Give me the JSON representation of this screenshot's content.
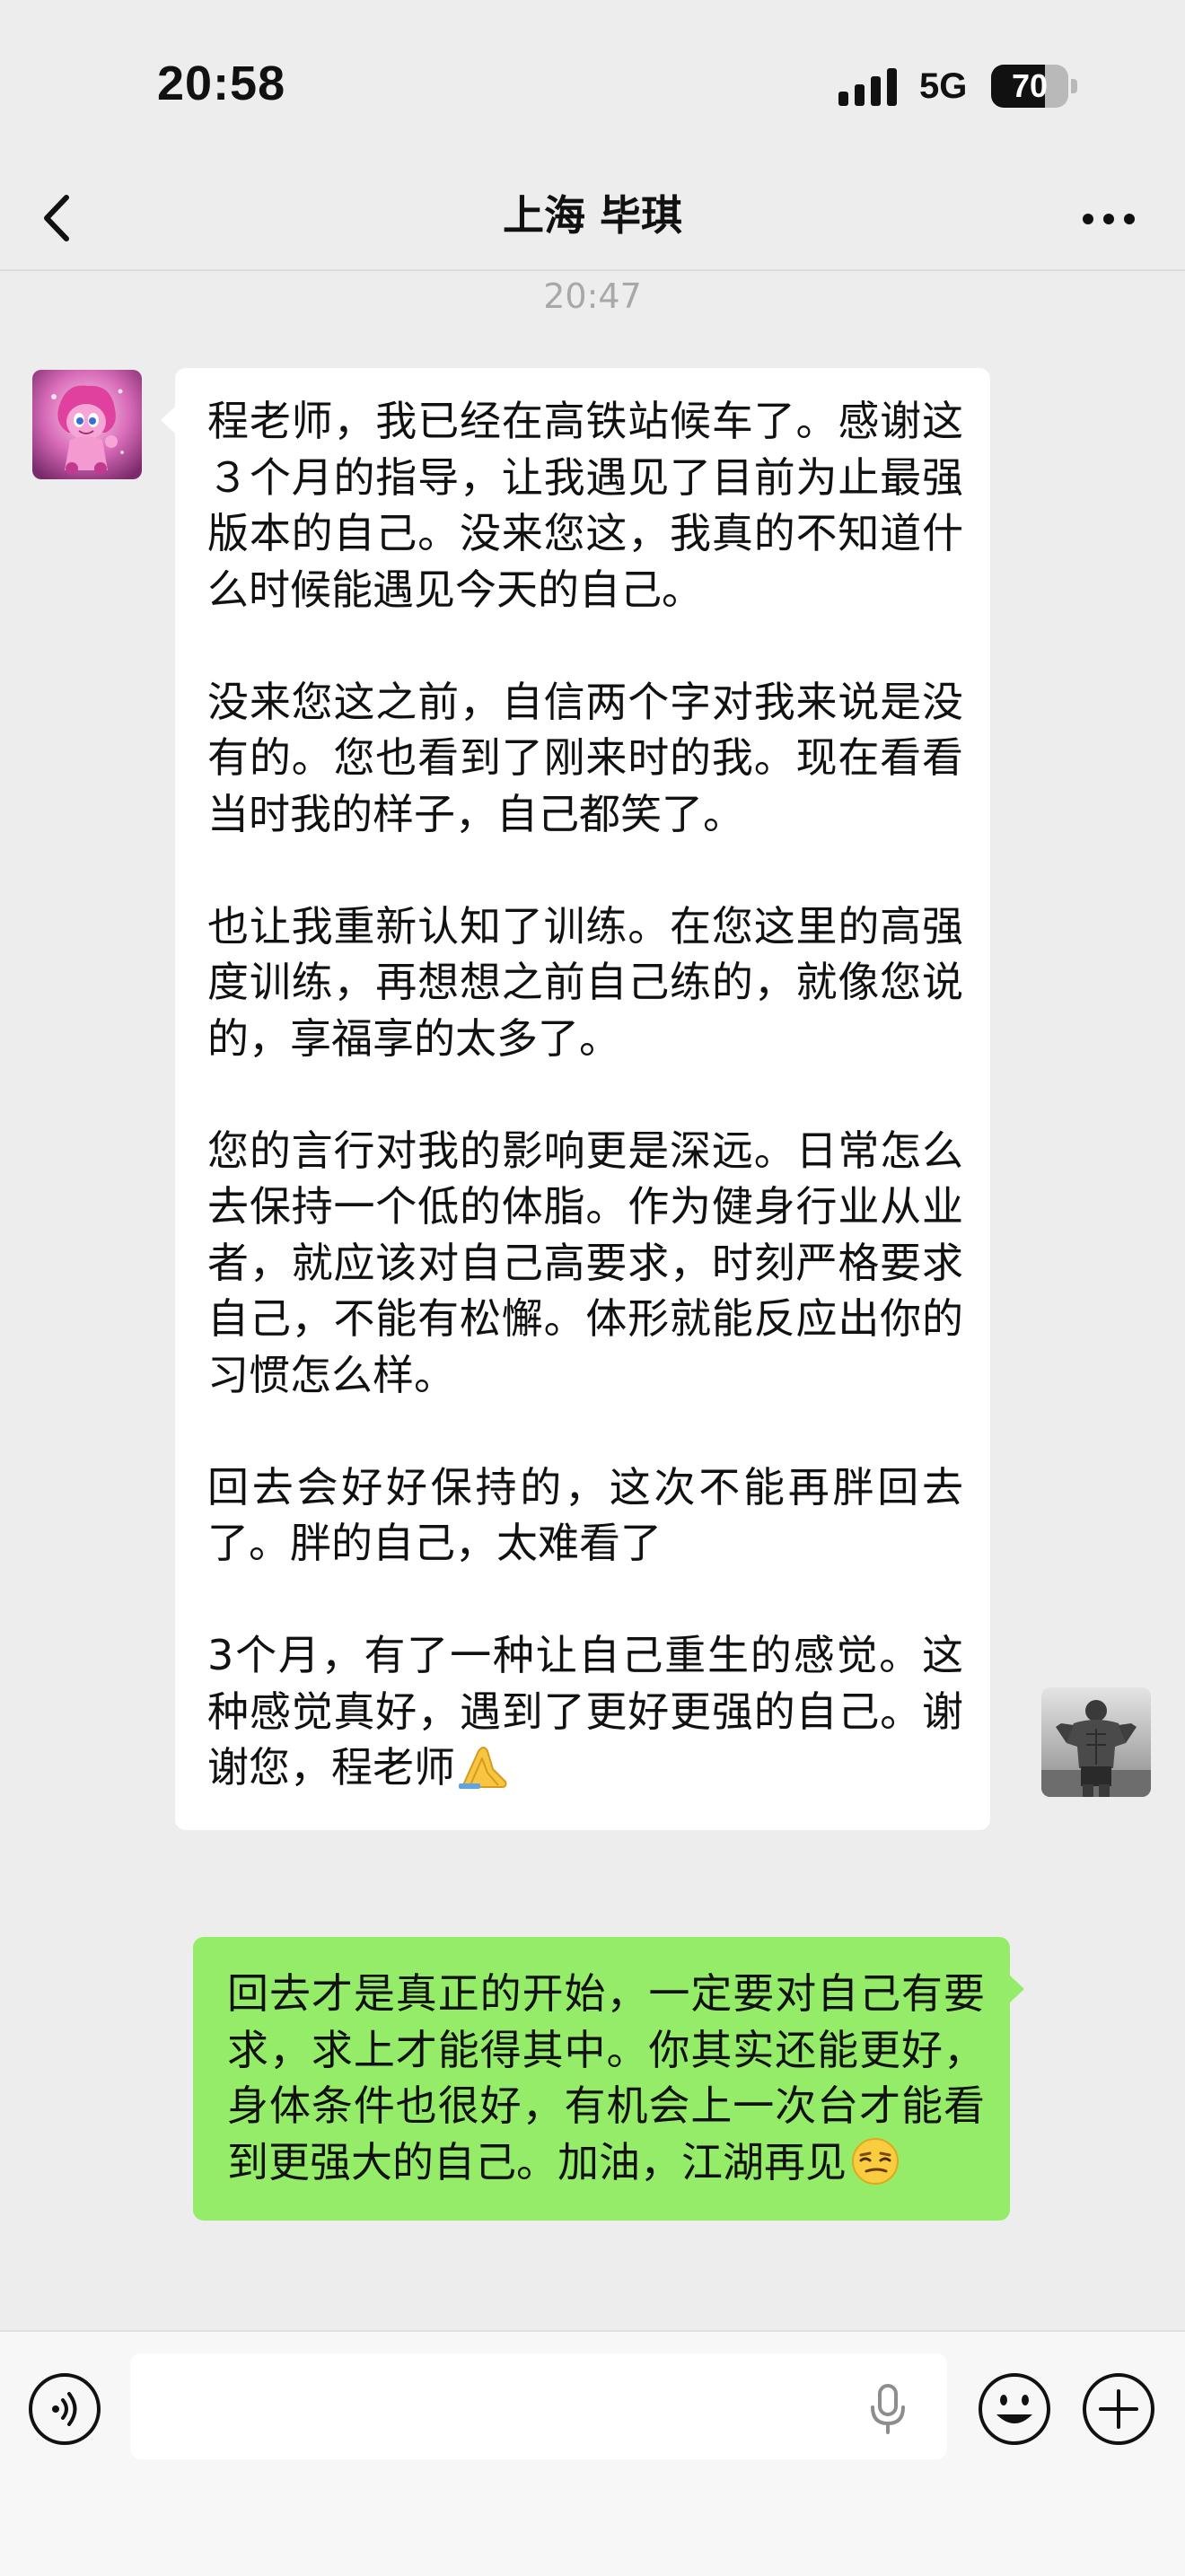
{
  "status_bar": {
    "time": "20:58",
    "network": "5G",
    "battery_level": "70",
    "battery_fraction": 0.7,
    "signal_icon": "cellular-signal-icon"
  },
  "nav": {
    "title": "上海 毕琪",
    "back_icon": "chevron-left-icon",
    "more_icon": "more-dots-icon"
  },
  "chat": {
    "timestamp": "20:47",
    "messages": [
      {
        "side": "left",
        "bubble_color": "#ffffff",
        "paragraphs": [
          "程老师，我已经在高铁站候车了。感谢这３个月的指导，让我遇见了目前为止最强版本的自己。没来您这，我真的不知道什么时候能遇见今天的自己。",
          "没来您这之前，自信两个字对我来说是没有的。您也看到了刚来时的我。现在看看当时我的样子，自己都笑了。",
          "也让我重新认知了训练。在您这里的高强度训练，再想想之前自己练的，就像您说的，享福享的太多了。",
          "您的言行对我的影响更是深远。日常怎么去保持一个低的体脂。作为健身行业从业者，就应该对自己高要求，时刻严格要求自己，不能有松懈。体形就能反应出你的习惯怎么样。",
          "回去会好好保持的，这次不能再胖回去了。胖的自己，太难看了",
          "3个月，有了一种让自己重生的感觉。这种感觉真好，遇到了更好更强的自己。谢谢您，程老师"
        ],
        "trailing_emoji": "praying-hands-emoji"
      },
      {
        "side": "right",
        "bubble_color": "#95ec69",
        "paragraphs": [
          "回去才是真正的开始，一定要对自己有要求，求上才能得其中。你其实还能更好，身体条件也很好，有机会上一次台才能看到更强大的自己。加油，江湖再见"
        ],
        "trailing_emoji": "smirking-face-emoji"
      }
    ]
  },
  "input_bar": {
    "text_value": "",
    "voice_icon": "voice-input-icon",
    "mic_icon": "microphone-icon",
    "emoji_icon": "emoji-face-icon",
    "plus_icon": "plus-circle-icon"
  }
}
